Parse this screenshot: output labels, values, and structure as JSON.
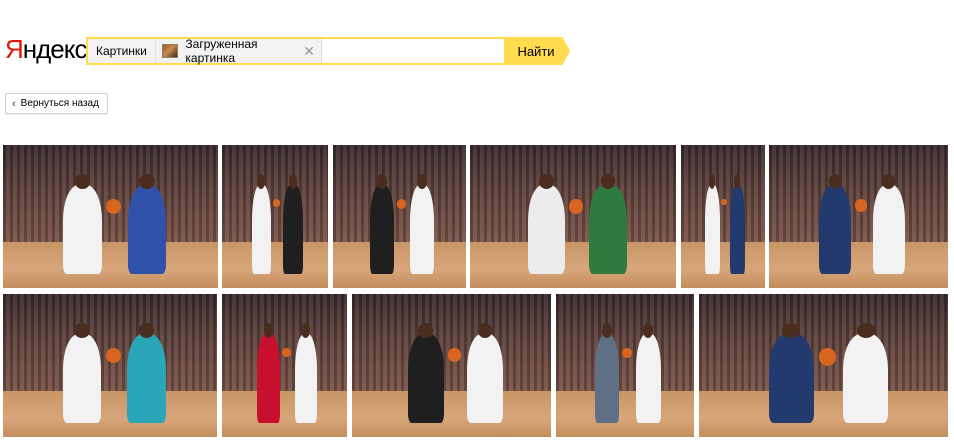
{
  "header": {
    "logo_first": "Я",
    "logo_rest": "ндекс",
    "search": {
      "chip_category": "Картинки",
      "chip_uploaded": "Загруженная картинка",
      "close_glyph": "✕",
      "query_value": "",
      "find_label": "Найти"
    }
  },
  "nav": {
    "back_label": "Вернуться назад",
    "back_glyph": "‹"
  },
  "colors": {
    "logo_red": "#e61400",
    "accent_yellow": "#ffdb4d"
  },
  "results": {
    "row1": [
      {
        "p1": "#f2f2f2",
        "p2": "#2f52a8"
      },
      {
        "p1": "#f2f2f2",
        "p2": "#1f1f1f"
      },
      {
        "p1": "#1f1f1f",
        "p2": "#f2f2f2"
      },
      {
        "p1": "#ececec",
        "p2": "#2c7a3f"
      },
      {
        "p1": "#f2f2f2",
        "p2": "#223a6e"
      },
      {
        "p1": "#223a6e",
        "p2": "#f2f2f2"
      }
    ],
    "row2": [
      {
        "p1": "#f2f2f2",
        "p2": "#2aa6b8"
      },
      {
        "p1": "#c8102e",
        "p2": "#f2f2f2"
      },
      {
        "p1": "#1f1f1f",
        "p2": "#f2f2f2"
      },
      {
        "p1": "#5f6f86",
        "p2": "#f2f2f2"
      },
      {
        "p1": "#223a6e",
        "p2": "#f2f2f2"
      }
    ]
  }
}
